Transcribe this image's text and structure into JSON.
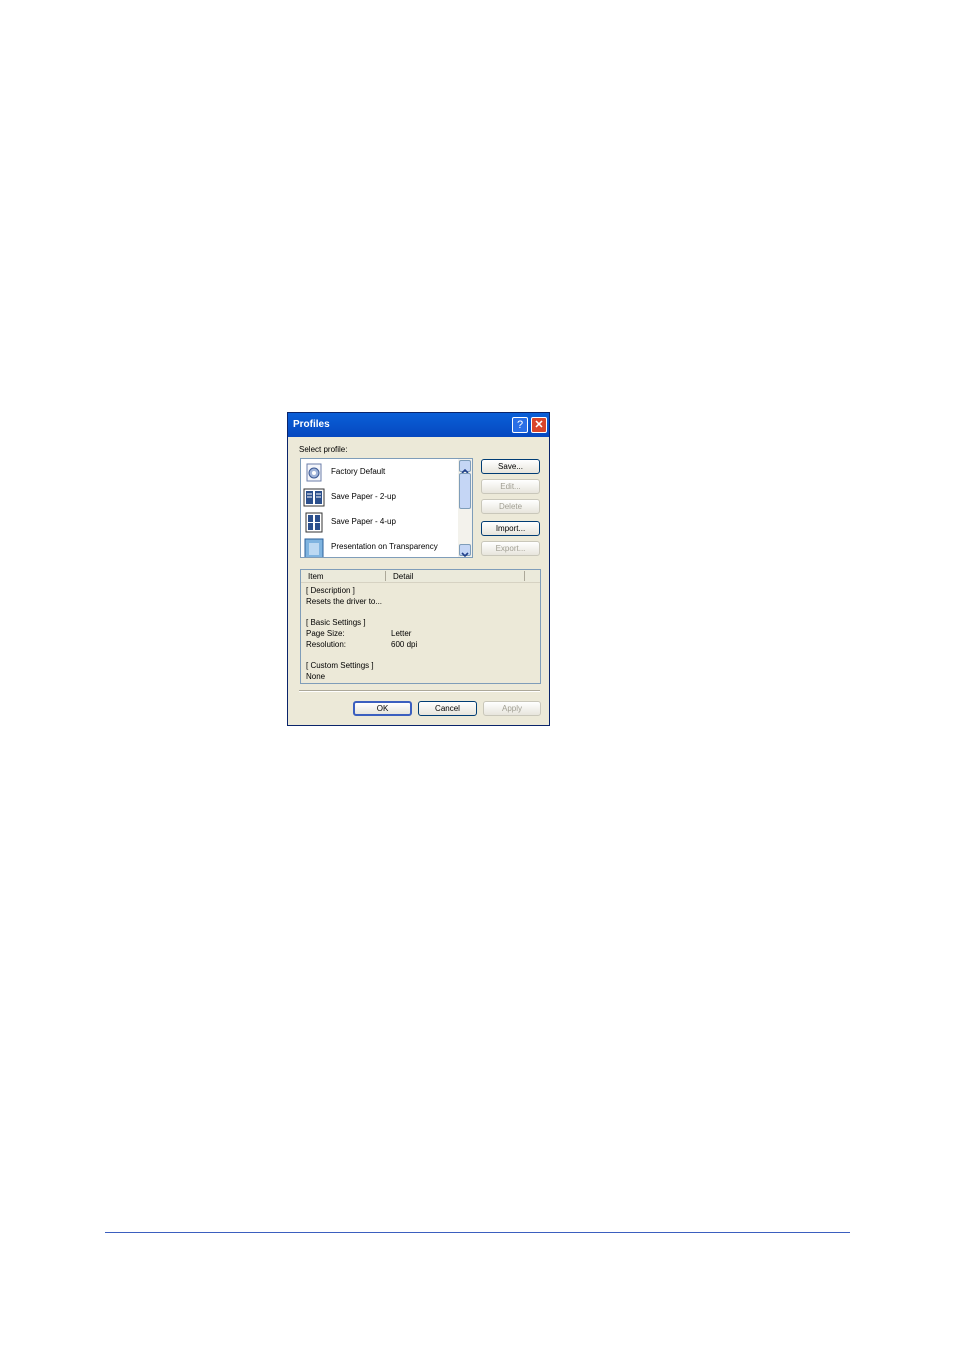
{
  "dialog": {
    "title": "Profiles",
    "select_label": "Select profile:",
    "profiles": [
      {
        "label": "Factory Default",
        "icon": "gear-document-icon"
      },
      {
        "label": "Save Paper - 2-up",
        "icon": "two-up-pages-icon"
      },
      {
        "label": "Save Paper - 4-up",
        "icon": "four-up-pages-icon"
      },
      {
        "label": "Presentation on Transparency",
        "icon": "transparency-icon"
      }
    ],
    "side_buttons": {
      "save": "Save...",
      "edit": "Edit...",
      "delete": "Delete",
      "import": "Import...",
      "export": "Export..."
    },
    "details": {
      "col_item": "Item",
      "col_detail": "Detail",
      "description_heading": "[ Description ]",
      "description_text": "Resets the driver to...",
      "basic_heading": "[ Basic Settings ]",
      "page_size_label": "Page Size:",
      "page_size_value": "Letter",
      "resolution_label": "Resolution:",
      "resolution_value": "600 dpi",
      "custom_heading": "[ Custom Settings ]",
      "custom_value": "None"
    },
    "footer_buttons": {
      "ok": "OK",
      "cancel": "Cancel",
      "apply": "Apply"
    }
  }
}
